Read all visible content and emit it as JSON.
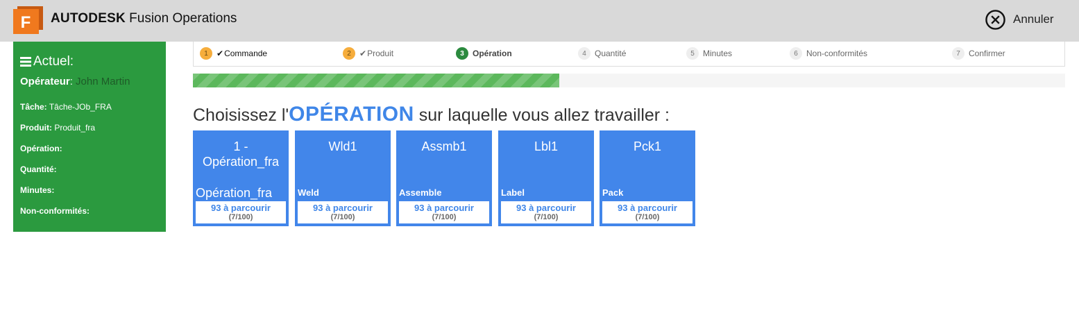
{
  "header": {
    "brand_bold": "AUTODESK",
    "brand_rest": "Fusion Operations",
    "logo_letter": "F",
    "cancel_label": "Annuler",
    "colors": {
      "background": "#d9d9d9",
      "logo_orange": "#f0791e"
    }
  },
  "sidebar": {
    "title": "Actuel:",
    "operator_label": "Opérateur",
    "operator_value": "John Martin",
    "rows": [
      {
        "label": "Tâche:",
        "value": "Tâche-JOb_FRA"
      },
      {
        "label": "Produit:",
        "value": "Produit_fra"
      },
      {
        "label": "Opération:",
        "value": ""
      },
      {
        "label": "Quantité:",
        "value": ""
      },
      {
        "label": "Minutes:",
        "value": ""
      },
      {
        "label": "Non-conformités:",
        "value": ""
      }
    ],
    "color": "#2b9a3f"
  },
  "steps": [
    {
      "num": "1",
      "label": "Commande",
      "check": "✔",
      "state": "done"
    },
    {
      "num": "2",
      "label": "Produit",
      "check": "✔",
      "state": "done"
    },
    {
      "num": "3",
      "label": "Opération",
      "check": "",
      "state": "active"
    },
    {
      "num": "4",
      "label": "Quantité",
      "check": "",
      "state": "pending"
    },
    {
      "num": "5",
      "label": "Minutes",
      "check": "",
      "state": "pending"
    },
    {
      "num": "6",
      "label": "Non-conformités",
      "check": "",
      "state": "pending"
    },
    {
      "num": "7",
      "label": "Confirmer",
      "check": "",
      "state": "pending"
    }
  ],
  "progress": {
    "fraction": 0.42,
    "color": "#5cb85c"
  },
  "heading": {
    "prefix": "Choisissez l'",
    "emphasis": "OPÉRATION",
    "suffix": " sur laquelle vous allez travailler :"
  },
  "operations": [
    {
      "name": "1 - Opération_fra",
      "description": "Opération_fra",
      "remaining": "93 à parcourir",
      "count": "(7/100)"
    },
    {
      "name": "Wld1",
      "description": "Weld",
      "remaining": "93 à parcourir",
      "count": "(7/100)"
    },
    {
      "name": "Assmb1",
      "description": "Assemble",
      "remaining": "93 à parcourir",
      "count": "(7/100)"
    },
    {
      "name": "Lbl1",
      "description": "Label",
      "remaining": "93 à parcourir",
      "count": "(7/100)"
    },
    {
      "name": "Pck1",
      "description": "Pack",
      "remaining": "93 à parcourir",
      "count": "(7/100)"
    }
  ],
  "tile_color": "#4286ea"
}
